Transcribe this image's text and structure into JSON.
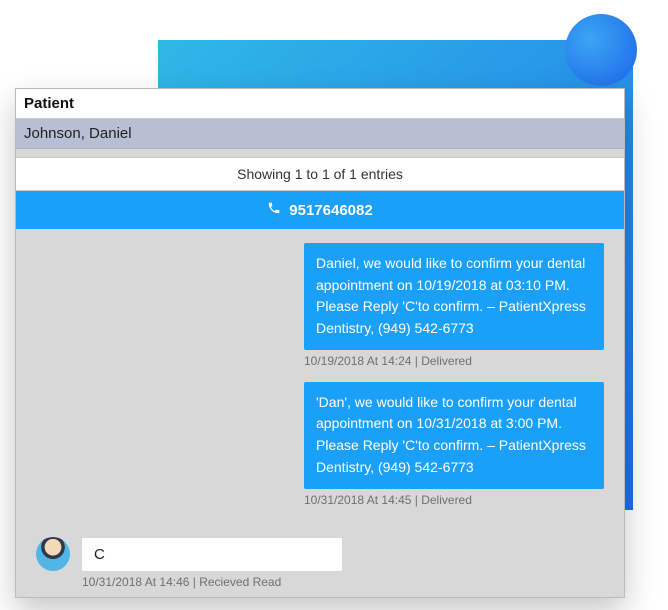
{
  "background": {
    "square_gradient": [
      "#2fb8e6",
      "#1e6eea"
    ],
    "circle_gradient": [
      "#3aa6f4",
      "#1d64e8"
    ]
  },
  "table": {
    "header": "Patient",
    "selected_patient": "Johnson, Daniel",
    "entries_text": "Showing 1 to 1 of 1 entries"
  },
  "phone": {
    "number": "9517646082",
    "icon": "phone-icon"
  },
  "messages": [
    {
      "text": "Daniel, we would like to confirm your dental appointment on 10/19/2018 at 03:10 PM. Please Reply 'C'to confirm. – PatientXpress Dentistry, (949) 542-6773",
      "meta": "10/19/2018 At 14:24 | Delivered"
    },
    {
      "text": "'Dan', we would like to confirm your dental appointment on 10/31/2018 at 3:00 PM. Please Reply 'C'to confirm. – PatientXpress Dentistry, (949) 542-6773",
      "meta": "10/31/2018 At 14:45 | Delivered"
    }
  ],
  "reply": {
    "text": "C",
    "meta": "10/31/2018 At 14:46 | Recieved Read"
  }
}
